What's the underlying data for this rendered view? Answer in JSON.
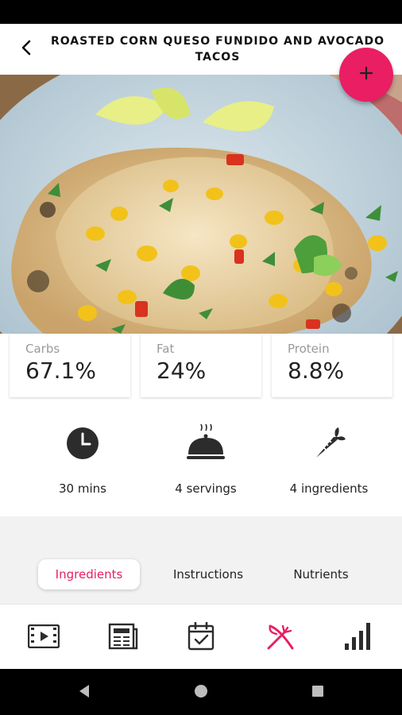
{
  "header": {
    "title": "ROASTED CORN QUESO FUNDIDO AND AVOCADO TACOS",
    "back_icon": "back-arrow-icon"
  },
  "fab": {
    "icon": "plus-icon",
    "color": "#e91e63"
  },
  "macros": [
    {
      "label": "Carbs",
      "value": "67.1%"
    },
    {
      "label": "Fat",
      "value": "24%"
    },
    {
      "label": "Protein",
      "value": "8.8%"
    }
  ],
  "stats": [
    {
      "icon": "clock-icon",
      "label": "30 mins"
    },
    {
      "icon": "serving-cloche-icon",
      "label": "4 servings"
    },
    {
      "icon": "carrot-icon",
      "label": "4 ingredients"
    }
  ],
  "tabs": [
    {
      "label": "Ingredients",
      "active": true
    },
    {
      "label": "Instructions",
      "active": false
    },
    {
      "label": "Nutrients",
      "active": false
    }
  ],
  "bottom_nav": [
    {
      "icon": "video-icon",
      "active": false
    },
    {
      "icon": "newspaper-icon",
      "active": false
    },
    {
      "icon": "calendar-check-icon",
      "active": false
    },
    {
      "icon": "fork-knife-icon",
      "active": true
    },
    {
      "icon": "bar-chart-icon",
      "active": false
    }
  ],
  "colors": {
    "accent": "#e91e63",
    "icon_dark": "#2c2c2c",
    "text_muted": "#9a9a9a"
  }
}
